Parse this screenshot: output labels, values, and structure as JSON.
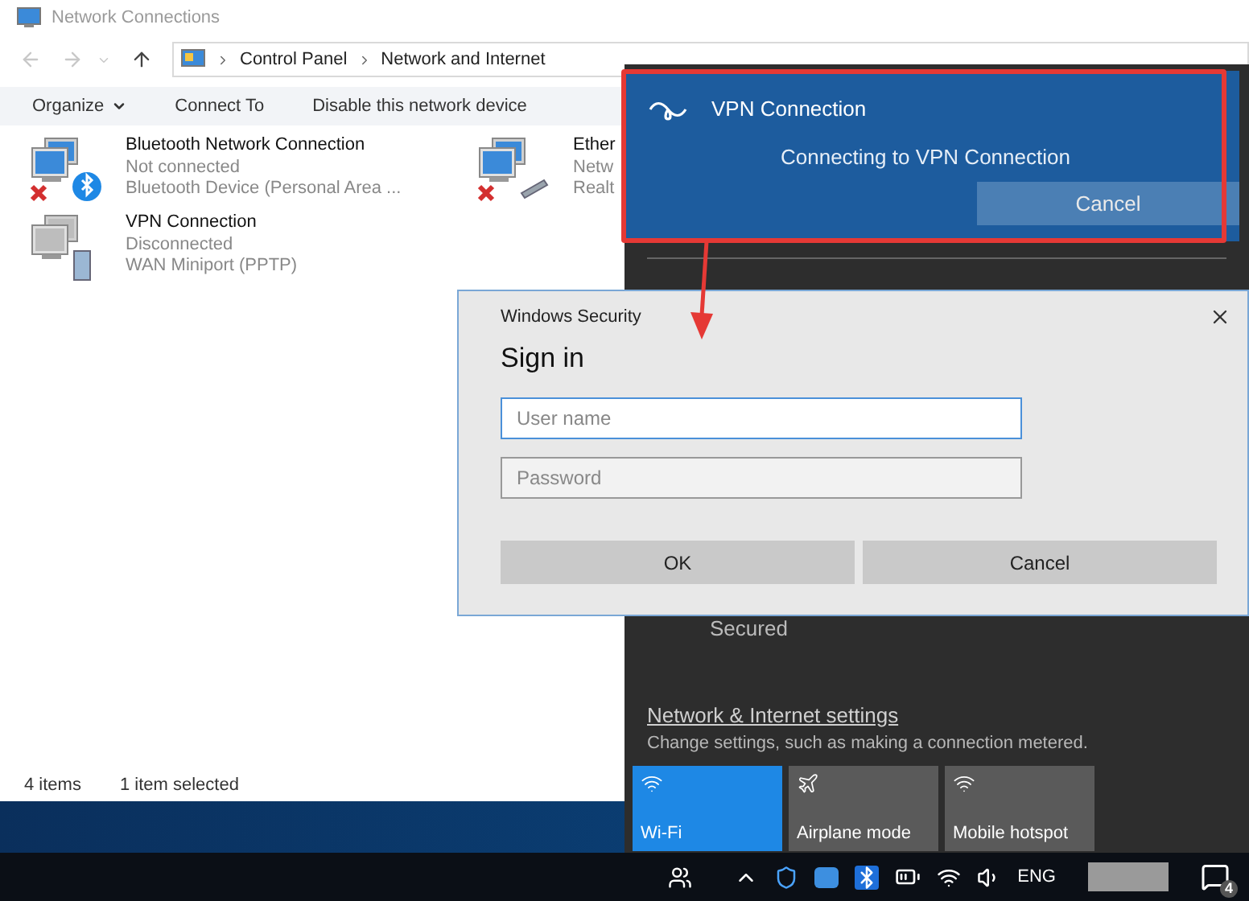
{
  "explorer": {
    "title": "Network Connections",
    "breadcrumbs": [
      "Control Panel",
      "Network and Internet"
    ],
    "toolbar": [
      {
        "label": "Organize",
        "dropdown": true
      },
      {
        "label": "Connect To",
        "dropdown": false
      },
      {
        "label": "Disable this network device",
        "dropdown": false
      }
    ],
    "connections": [
      {
        "kind": "bluetooth",
        "name": "Bluetooth Network Connection",
        "status": "Not connected",
        "device": "Bluetooth Device (Personal Area ...",
        "error": true
      },
      {
        "kind": "ethernet",
        "name": "Ether",
        "status": "Netw",
        "device": "Realt",
        "error": true
      },
      {
        "kind": "vpn",
        "name": "VPN Connection",
        "status": "Disconnected",
        "device": "WAN Miniport (PPTP)",
        "error": false
      }
    ],
    "status_bar": [
      "4 items",
      "1 item selected"
    ]
  },
  "vpn_toast": {
    "title": "VPN Connection",
    "message": "Connecting to VPN Connection",
    "button": "Cancel"
  },
  "sign_in": {
    "window_title": "Windows Security",
    "heading": "Sign in",
    "fields": [
      {
        "placeholder": "User name",
        "focused": true
      },
      {
        "placeholder": "Password",
        "focused": false
      }
    ],
    "buttons": [
      "OK",
      "Cancel"
    ]
  },
  "network_flyout": {
    "network_status": "Secured",
    "settings_link": "Network & Internet settings",
    "settings_description": "Change settings, such as making a connection metered.",
    "tiles": [
      {
        "kind": "wifi",
        "label": "Wi-Fi",
        "on": true
      },
      {
        "kind": "airplane",
        "label": "Airplane mode",
        "on": false
      },
      {
        "kind": "hotspot",
        "label": "Mobile hotspot",
        "on": false
      }
    ]
  },
  "taskbar": {
    "language": "ENG",
    "notification_count": "4"
  }
}
